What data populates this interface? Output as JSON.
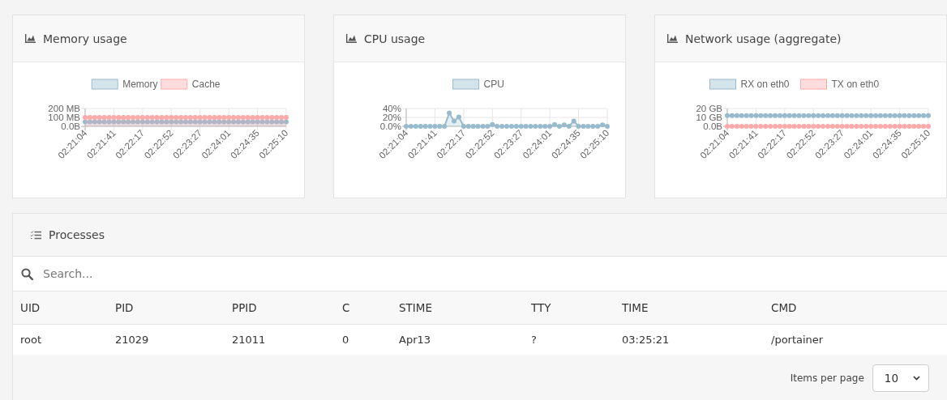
{
  "stat_cards": [
    {
      "title": "Memory usage",
      "chart_data": {
        "type": "area",
        "legend": "top",
        "categories": [
          "02:21:04",
          null,
          null,
          null,
          null,
          null,
          "02:21:41",
          null,
          null,
          null,
          null,
          null,
          "02:22:17",
          null,
          null,
          null,
          null,
          null,
          "02:22:52",
          null,
          null,
          null,
          null,
          null,
          "02:23:27",
          null,
          null,
          null,
          null,
          null,
          "02:24:01",
          null,
          null,
          null,
          null,
          null,
          "02:24:35",
          null,
          null,
          null,
          null,
          null,
          "02:25:10"
        ],
        "ylim": [
          0,
          200
        ],
        "yticks": [
          {
            "value": 0,
            "label": "0.0B"
          },
          {
            "value": 100,
            "label": "100 MB"
          },
          {
            "value": 200,
            "label": "200 MB"
          }
        ],
        "series": [
          {
            "name": "Memory",
            "color": "#97bbcd",
            "marker": "circle",
            "values": [
              50,
              50,
              50,
              50,
              50,
              50,
              50,
              50,
              50,
              50,
              50,
              50,
              50,
              50,
              50,
              50,
              50,
              50,
              50,
              50,
              50,
              50,
              50,
              50,
              50,
              50,
              50,
              50,
              50,
              50,
              50,
              50,
              50,
              50,
              50,
              50,
              50,
              50,
              50,
              50,
              50,
              50,
              50
            ]
          },
          {
            "name": "Cache",
            "color": "#fba9a9",
            "marker": "circle",
            "values": [
              100,
              100,
              100,
              100,
              100,
              100,
              100,
              100,
              100,
              100,
              100,
              100,
              100,
              100,
              100,
              100,
              100,
              100,
              100,
              100,
              100,
              100,
              100,
              100,
              100,
              100,
              100,
              100,
              100,
              100,
              100,
              100,
              100,
              100,
              100,
              100,
              100,
              100,
              100,
              100,
              100,
              100,
              100
            ]
          }
        ]
      }
    },
    {
      "title": "CPU usage",
      "chart_data": {
        "type": "area",
        "legend": "top",
        "categories": [
          "02:21:04",
          null,
          null,
          null,
          null,
          null,
          "02:21:41",
          null,
          null,
          null,
          null,
          null,
          "02:22:17",
          null,
          null,
          null,
          null,
          null,
          "02:22:52",
          null,
          null,
          null,
          null,
          null,
          "02:23:27",
          null,
          null,
          null,
          null,
          null,
          "02:24:01",
          null,
          null,
          null,
          null,
          null,
          "02:24:35",
          null,
          null,
          null,
          null,
          null,
          "02:25:10"
        ],
        "ylim": [
          0,
          40
        ],
        "yticks": [
          {
            "value": 0,
            "label": "0.0%"
          },
          {
            "value": 20,
            "label": "20%"
          },
          {
            "value": 40,
            "label": "40%"
          }
        ],
        "series": [
          {
            "name": "CPU",
            "color": "#97bbcd",
            "marker": "circle",
            "values": [
              0,
              0,
              0,
              0,
              0,
              0,
              0,
              0,
              0,
              30,
              12,
              21,
              0,
              0,
              0,
              0,
              0,
              0,
              4,
              0,
              0,
              0,
              0,
              0,
              0,
              0,
              0,
              0,
              0,
              0,
              0,
              4,
              0,
              3,
              0,
              12,
              0,
              0,
              0,
              0,
              0,
              3,
              0
            ]
          }
        ]
      }
    },
    {
      "title": "Network usage (aggregate)",
      "chart_data": {
        "type": "line",
        "legend": "top",
        "categories": [
          "02:21:04",
          null,
          null,
          null,
          null,
          null,
          "02:21:41",
          null,
          null,
          null,
          null,
          null,
          "02:22:17",
          null,
          null,
          null,
          null,
          null,
          "02:22:52",
          null,
          null,
          null,
          null,
          null,
          "02:23:27",
          null,
          null,
          null,
          null,
          null,
          "02:24:01",
          null,
          null,
          null,
          null,
          null,
          "02:24:35",
          null,
          null,
          null,
          null,
          null,
          "02:25:10"
        ],
        "ylim": [
          0,
          20
        ],
        "yticks": [
          {
            "value": 0,
            "label": "0.0B"
          },
          {
            "value": 10,
            "label": "10 GB"
          },
          {
            "value": 20,
            "label": "20 GB"
          }
        ],
        "series": [
          {
            "name": "RX on eth0",
            "color": "#97bbcd",
            "marker": "circle",
            "values": [
              12,
              12,
              12,
              12,
              12,
              12,
              12,
              12,
              12,
              12,
              12,
              12,
              12,
              12,
              12,
              12,
              12,
              12,
              12,
              12,
              12,
              12,
              12,
              12,
              12,
              12,
              12,
              12,
              12,
              12,
              12,
              12,
              12,
              12,
              12,
              12,
              12,
              12,
              12,
              12,
              12,
              12,
              12
            ]
          },
          {
            "name": "TX on eth0",
            "color": "#fba9a9",
            "marker": "circle",
            "values": [
              0,
              0,
              0,
              0,
              0,
              0,
              0,
              0,
              0,
              0,
              0,
              0,
              0,
              0,
              0,
              0,
              0,
              0,
              0,
              0,
              0,
              0,
              0,
              0,
              0,
              0,
              0,
              0,
              0,
              0,
              0,
              0,
              0,
              0,
              0,
              0,
              0,
              0,
              0,
              0,
              0,
              0,
              0
            ]
          }
        ]
      }
    }
  ],
  "processes": {
    "title": "Processes",
    "search": {
      "placeholder": "Search..."
    },
    "columns": [
      "UID",
      "PID",
      "PPID",
      "C",
      "STIME",
      "TTY",
      "TIME",
      "CMD"
    ],
    "rows": [
      {
        "cells": [
          "root",
          "21029",
          "21011",
          "0",
          "Apr13",
          "?",
          "03:25:21",
          "/portainer"
        ]
      }
    ],
    "items_per_page_label": "Items per page",
    "page_size": "10"
  }
}
